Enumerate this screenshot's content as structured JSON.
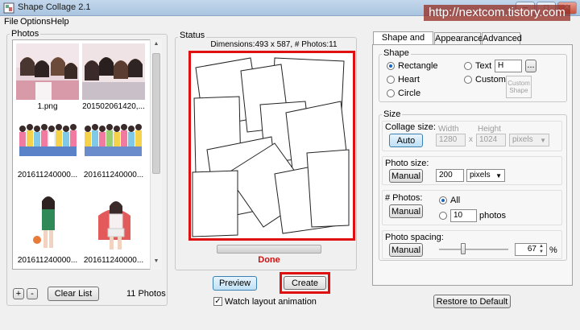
{
  "window": {
    "title": "Shape Collage 2.1",
    "watermark": "http://nextcom.tistory.com",
    "minimize": "–",
    "maximize": "□",
    "close": "✕"
  },
  "menu": [
    "File",
    "Options",
    "Help"
  ],
  "photos": {
    "group_label": "Photos",
    "items": [
      {
        "label": "1.png"
      },
      {
        "label": "201502061420,..."
      },
      {
        "label": "201611240000..."
      },
      {
        "label": "201611240000..."
      },
      {
        "label": "201611240000..."
      },
      {
        "label": "201611240000..."
      }
    ],
    "add_label": "+",
    "remove_label": "-",
    "clear_label": "Clear List",
    "count": "11 Photos"
  },
  "status": {
    "group_label": "Status",
    "dimensions": "Dimensions:493 x 587, # Photos:11",
    "done": "Done",
    "preview_label": "Preview",
    "create_label": "Create",
    "watch_label": "Watch layout animation",
    "watch_checked": true
  },
  "tabs": [
    {
      "label": "Shape and Size",
      "active": true
    },
    {
      "label": "Appearance",
      "active": false
    },
    {
      "label": "Advanced",
      "active": false
    }
  ],
  "shape": {
    "group_label": "Shape",
    "options": [
      {
        "label": "Rectangle",
        "selected": true
      },
      {
        "label": "Heart",
        "selected": false
      },
      {
        "label": "Circle",
        "selected": false
      },
      {
        "label": "Text",
        "selected": false
      },
      {
        "label": "Custom",
        "selected": false
      }
    ],
    "text_value": "H",
    "browse_label": "...",
    "custom_shape_label": "Custom Shape"
  },
  "size": {
    "group_label": "Size",
    "collage_size_label": "Collage size:",
    "auto_label": "Auto",
    "width_label": "Width",
    "height_label": "Height",
    "width_value": "1280",
    "x_label": "x",
    "height_value": "1024",
    "unit_value": "pixels",
    "photo_size_label": "Photo size:",
    "photo_size_manual": "Manual",
    "photo_size_value": "200",
    "photo_size_unit": "pixels",
    "num_photos_label": "# Photos:",
    "num_photos_manual": "Manual",
    "all_label": "All",
    "all_selected": true,
    "photos_value": "10",
    "photos_unit": "photos",
    "spacing_label": "Photo spacing:",
    "spacing_manual": "Manual",
    "spacing_value": "67",
    "spacing_unit": "%",
    "spacing_level": 0.67
  },
  "restore_label": "Restore to Default",
  "colors": {
    "highlight": "#e01010",
    "accent": "#3c7fb1"
  }
}
